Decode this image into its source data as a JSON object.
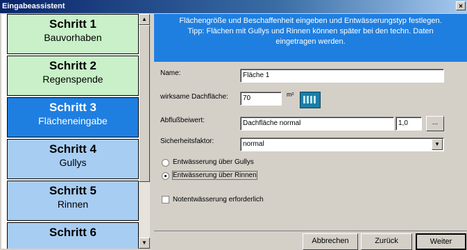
{
  "window": {
    "title": "Eingabeassistent",
    "close_glyph": "×"
  },
  "steps": [
    {
      "num": "Schritt 1",
      "label": "Bauvorhaben",
      "state": "done"
    },
    {
      "num": "Schritt 2",
      "label": "Regenspende",
      "state": "done"
    },
    {
      "num": "Schritt 3",
      "label": "Flächeneingabe",
      "state": "active"
    },
    {
      "num": "Schritt 4",
      "label": "Gullys",
      "state": "todo"
    },
    {
      "num": "Schritt 5",
      "label": "Rinnen",
      "state": "todo"
    },
    {
      "num": "Schritt 6",
      "label": "",
      "state": "todo"
    }
  ],
  "hint": {
    "line1": "Flächengröße und Beschaffenheit eingeben und Entwässerungstyp festlegen.",
    "line2": "Tipp: Flächen mit Gullys und Rinnen können später bei den techn. Daten",
    "line3": "eingetragen werden."
  },
  "form": {
    "name_label": "Name:",
    "name_value": "Fläche 1",
    "area_label": "wirksame Dachfläche:",
    "area_value": "70",
    "area_unit": "m²",
    "coeff_label": "Abflußbeiwert:",
    "coeff_type": "Dachfläche normal",
    "coeff_value": "1,0",
    "coeff_button": "...",
    "safety_label": "Sicherheitsfaktor:",
    "safety_value": "normal",
    "radio_gullys": "Entwässerung über Gullys",
    "radio_rinnen": "Entwässerung über Rinnen",
    "selected_radio": "rinnen",
    "emergency_label": "Notentwässerung erforderlich",
    "emergency_checked": false
  },
  "buttons": {
    "cancel": "Abbrechen",
    "back": "Zurück",
    "next": "Weiter"
  },
  "colors": {
    "active_step": "#1f7fe0",
    "done_step": "#c9f0c8",
    "todo_step": "#a8cdf2"
  }
}
